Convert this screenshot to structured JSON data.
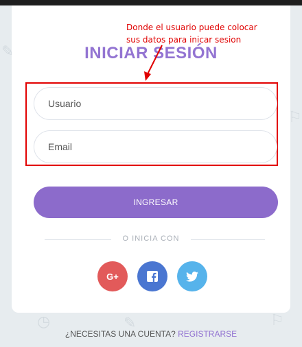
{
  "annotation": {
    "line1": "Donde el usuario puede colocar",
    "line2": "sus datos para inicar sesion"
  },
  "login": {
    "title": "INICIAR SESIÓN",
    "username_placeholder": "Usuario",
    "email_placeholder": "Email",
    "submit_label": "INGRESAR",
    "divider_text": "O INICIA CON"
  },
  "social": {
    "google_label": "G+",
    "google_color": "#e25a5a",
    "facebook_color": "#4a76d1",
    "twitter_color": "#56b3eb"
  },
  "footer": {
    "question": "¿NECESITAS UNA CUENTA?",
    "register_link": "REGISTRARSE"
  },
  "colors": {
    "accent": "#8c6bcb",
    "annotation": "#e00000"
  }
}
